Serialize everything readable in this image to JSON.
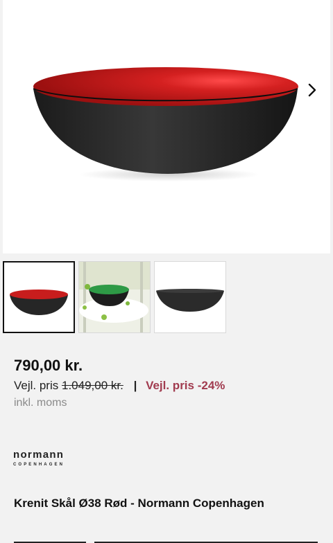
{
  "gallery": {
    "next_icon": "chevron-right-icon",
    "thumbnails": [
      {
        "name": "thumbnail-red-bowl",
        "active": true
      },
      {
        "name": "thumbnail-green-bowl-lifestyle",
        "active": false
      },
      {
        "name": "thumbnail-black-bowl",
        "active": false
      }
    ],
    "colors": {
      "bowl_inner": "#c81d1d",
      "bowl_outer": "#2a2a2a",
      "green_inner": "#2e9a46"
    }
  },
  "product": {
    "price": "790,00 kr.",
    "rrp_label": "Vejl. pris",
    "rrp_old": "1.049,00 kr.",
    "separator": "|",
    "discount": "Vejl. pris -24%",
    "vat_note": "inkl. moms",
    "title": "Krenit Skål Ø38 Rød - Normann Copenhagen"
  },
  "brand": {
    "name": "normann",
    "sub": "COPENHAGEN"
  }
}
